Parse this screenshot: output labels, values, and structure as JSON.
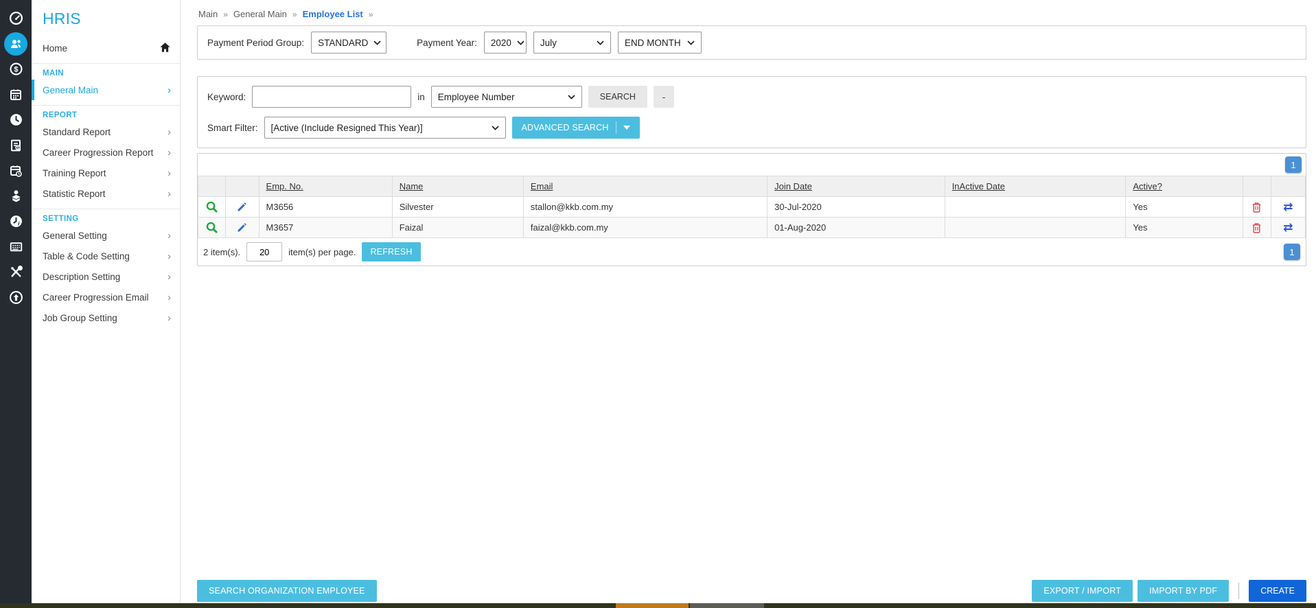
{
  "app": {
    "title": "HRIS"
  },
  "rail": {
    "icons": [
      {
        "name": "dashboard-icon",
        "active": false
      },
      {
        "name": "employees-icon",
        "active": true
      },
      {
        "name": "payroll-icon",
        "active": false
      },
      {
        "name": "calendar-icon",
        "active": false
      },
      {
        "name": "clock-icon",
        "active": false
      },
      {
        "name": "payslip-icon",
        "active": false
      },
      {
        "name": "schedule-icon",
        "active": false
      },
      {
        "name": "training-icon",
        "active": false
      },
      {
        "name": "time-history-icon",
        "active": false
      },
      {
        "name": "calculator-icon",
        "active": false
      },
      {
        "name": "tools-icon",
        "active": false
      },
      {
        "name": "upload-icon",
        "active": false
      }
    ]
  },
  "sidebar": {
    "chevron": "›",
    "home_label": "Home",
    "sections": [
      {
        "header": "MAIN",
        "items": [
          {
            "label": "General Main",
            "active": true
          }
        ]
      },
      {
        "header": "REPORT",
        "items": [
          {
            "label": "Standard Report",
            "active": false
          },
          {
            "label": "Career Progression Report",
            "active": false
          },
          {
            "label": "Training Report",
            "active": false
          },
          {
            "label": "Statistic Report",
            "active": false
          }
        ]
      },
      {
        "header": "SETTING",
        "items": [
          {
            "label": "General Setting",
            "active": false
          },
          {
            "label": "Table & Code Setting",
            "active": false
          },
          {
            "label": "Description Setting",
            "active": false
          },
          {
            "label": "Career Progression Email",
            "active": false
          },
          {
            "label": "Job Group Setting",
            "active": false
          }
        ]
      }
    ]
  },
  "breadcrumb": {
    "separator": "»",
    "items": [
      "Main",
      "General Main",
      "Employee List"
    ]
  },
  "payment_bar": {
    "period_group_label": "Payment Period Group:",
    "period_group_value": "STANDARD",
    "year_label": "Payment Year:",
    "year_value": "2020",
    "month_value": "July",
    "cycle_value": "END MONTH"
  },
  "search_panel": {
    "keyword_label": "Keyword:",
    "keyword_value": "",
    "in_label": "in",
    "field_value": "Employee Number",
    "search_button": "SEARCH",
    "minus_button": "-",
    "smart_filter_label": "Smart Filter:",
    "smart_filter_value": "[Active (Include Resigned This Year)]",
    "advanced_search_button": "ADVANCED SEARCH"
  },
  "table": {
    "page_badge": "1",
    "columns": [
      "Emp. No.",
      "Name",
      "Email",
      "Join Date",
      "InActive Date",
      "Active?"
    ],
    "rows": [
      {
        "emp_no": "M3656",
        "name": "Silvester",
        "email": "stallon@kkb.com.my",
        "join_date": "30-Jul-2020",
        "inactive_date": "",
        "active": "Yes"
      },
      {
        "emp_no": "M3657",
        "name": "Faizal",
        "email": "faizal@kkb.com.my",
        "join_date": "01-Aug-2020",
        "inactive_date": "",
        "active": "Yes"
      }
    ],
    "footer": {
      "count_text": "2 item(s).",
      "per_page_value": "20",
      "per_page_label": "item(s) per page.",
      "refresh_button": "REFRESH",
      "page_badge": "1"
    },
    "icons": {
      "transfer_glyph": "⇄"
    }
  },
  "actions": {
    "search_org_button": "SEARCH ORGANIZATION EMPLOYEE",
    "export_import_button": "EXPORT / IMPORT",
    "import_pdf_button": "IMPORT BY PDF",
    "create_button": "CREATE"
  },
  "colors": {
    "accent": "#1aa7e0",
    "rail_bg": "#262b32",
    "button_cyan": "#4bbee0",
    "create_blue": "#1065d8",
    "badge_blue": "#4a90d3",
    "breadcrumb_active": "#2374d9",
    "view_green": "#1fa83d",
    "edit_blue": "#2f6fd6",
    "delete_red": "#e05252",
    "transfer_blue": "#2b50d7"
  }
}
